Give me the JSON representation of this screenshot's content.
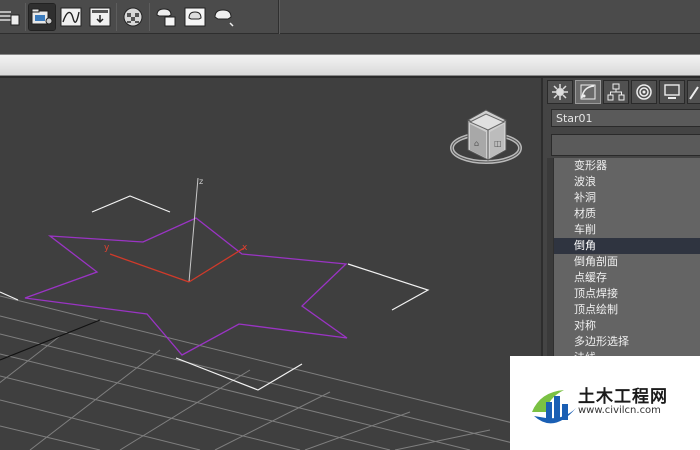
{
  "toolbar": {
    "buttons": [
      {
        "icon": "layer-list-icon"
      },
      {
        "icon": "scene-explorer-icon",
        "active": true
      },
      {
        "icon": "curve-editor-icon"
      },
      {
        "icon": "schematic-view-icon"
      },
      {
        "icon": "material-editor-icon"
      },
      {
        "icon": "render-setup-icon"
      },
      {
        "icon": "rendered-frame-window-icon"
      },
      {
        "icon": "render-production-icon"
      }
    ]
  },
  "command_panel": {
    "tabs": [
      {
        "icon": "create-icon"
      },
      {
        "icon": "modify-icon",
        "active": true
      },
      {
        "icon": "hierarchy-icon"
      },
      {
        "icon": "motion-icon"
      },
      {
        "icon": "display-icon"
      },
      {
        "icon": "utilities-icon"
      }
    ],
    "object_name": "Star01",
    "modifier_list": {
      "items": [
        {
          "label": "变形器"
        },
        {
          "label": "波浪"
        },
        {
          "label": "补洞"
        },
        {
          "label": "材质"
        },
        {
          "label": "车削"
        },
        {
          "label": "倒角",
          "selected": true
        },
        {
          "label": "倒角剖面"
        },
        {
          "label": "点缓存"
        },
        {
          "label": "顶点焊接"
        },
        {
          "label": "顶点绘制"
        },
        {
          "label": "对称"
        },
        {
          "label": "多边形选择"
        },
        {
          "label": "法线"
        }
      ]
    }
  },
  "viewport": {
    "view_cube": "view-cube-icon",
    "axis_labels": {
      "z": "z",
      "y": "y",
      "x": "x"
    }
  },
  "watermark": {
    "name": "土木工程网",
    "url": "www.civilcn.com"
  }
}
